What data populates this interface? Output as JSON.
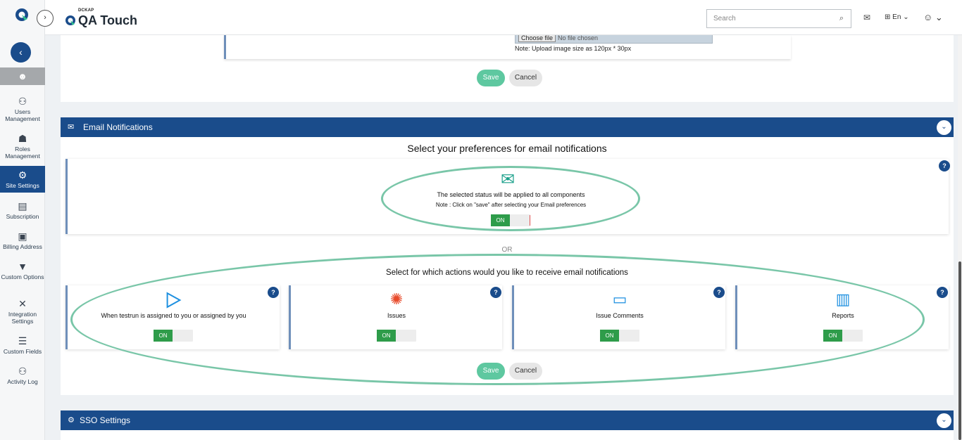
{
  "header": {
    "brand_small": "DCKAP",
    "brand_name": "QA Touch",
    "search_placeholder": "Search",
    "language": "En",
    "expand_glyph": "›",
    "dropdown_glyph": "⌄"
  },
  "sidebar": {
    "back_glyph": "‹",
    "items": [
      {
        "label": "Users Management",
        "icon": "users-icon"
      },
      {
        "label": "Roles Management",
        "icon": "roles-icon"
      },
      {
        "label": "Site Settings",
        "icon": "gears-icon"
      },
      {
        "label": "Subscription",
        "icon": "document-icon"
      },
      {
        "label": "Billing Address",
        "icon": "address-card-icon"
      },
      {
        "label": "Custom Options",
        "icon": "filter-icon"
      },
      {
        "label": "Integration Settings",
        "icon": "tools-icon"
      },
      {
        "label": "Custom Fields",
        "icon": "sliders-icon"
      },
      {
        "label": "Activity Log",
        "icon": "log-icon"
      }
    ]
  },
  "upload": {
    "choose_label": "Choose file",
    "file_status": "No file chosen",
    "note": "Note: Upload image size as 120px * 30px"
  },
  "top_actions": {
    "save": "Save",
    "cancel": "Cancel"
  },
  "email_section": {
    "title": "Email Notifications",
    "preferences_title": "Select your preferences for email notifications",
    "status_line": "The selected status will be applied to all components",
    "status_note": "Note : Click on \"save\" after selecting your Email preferences",
    "status_toggle": "ON",
    "or_label": "OR",
    "actions_title": "Select for which actions would you like to receive email notifications",
    "actions": [
      {
        "label": "When testrun is assigned to you or assigned by you",
        "toggle": "ON",
        "icon": "play-icon",
        "color": "#1e90e0"
      },
      {
        "label": "Issues",
        "toggle": "ON",
        "icon": "bug-icon",
        "color": "#e84a2a"
      },
      {
        "label": "Issue Comments",
        "toggle": "ON",
        "icon": "comment-icon",
        "color": "#1e90e0"
      },
      {
        "label": "Reports",
        "toggle": "ON",
        "icon": "report-icon",
        "color": "#1e90e0"
      }
    ],
    "help_glyph": "?",
    "save": "Save",
    "cancel": "Cancel"
  },
  "sso_section": {
    "title": "SSO Settings"
  },
  "colors": {
    "primary": "#1a4c8b",
    "save_green": "#5ec8a0",
    "toggle_green": "#2e9c4a",
    "highlight_ellipse": "#79c6a8"
  }
}
